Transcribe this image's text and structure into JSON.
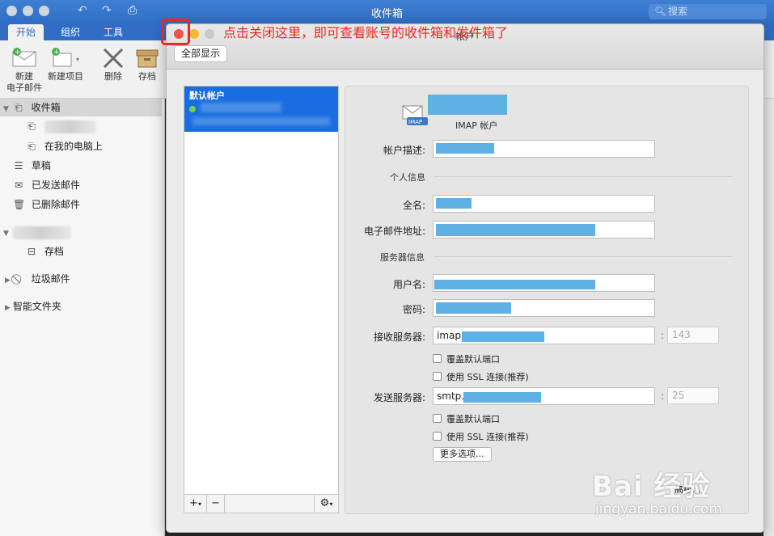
{
  "window": {
    "title": "收件箱"
  },
  "search": {
    "placeholder": "搜索"
  },
  "ribbon": {
    "tabs": [
      "开始",
      "组织",
      "工具"
    ],
    "buttons": {
      "new_email_line1": "新建",
      "new_email_line2": "电子邮件",
      "new_item": "新建项目",
      "delete": "删除",
      "archive": "存档"
    }
  },
  "sidebar": {
    "inbox": "收件箱",
    "on_my_computer": "在我的电脑上",
    "drafts": "草稿",
    "sent": "已发送邮件",
    "deleted": "已删除邮件",
    "archive": "存档",
    "junk": "垃圾邮件",
    "smart_folders": "智能文件夹"
  },
  "dialog": {
    "title": "帐户",
    "show_all": "全部显示",
    "default_account_label": "默认帐户",
    "account_type": "IMAP 帐户",
    "labels": {
      "description": "帐户描述:",
      "personal_info": "个人信息",
      "full_name": "全名:",
      "email": "电子邮件地址:",
      "server_info": "服务器信息",
      "username": "用户名:",
      "password": "密码:",
      "incoming": "接收服务器:",
      "outgoing": "发送服务器:"
    },
    "incoming_prefix": "imap.",
    "outgoing_prefix": "smtp.",
    "incoming_port": "143",
    "outgoing_port": "25",
    "override_port": "覆盖默认端口",
    "use_ssl": "使用 SSL 连接(推荐)",
    "more_options": "更多选项...",
    "advanced": "高级...",
    "list_add": "+",
    "list_remove": "−"
  },
  "annotation": {
    "text": "点击关闭这里，即可查看账号的收件箱和发件箱了"
  },
  "watermark": {
    "main": "Bai 经验",
    "sub": "jingyan.baidu.com"
  },
  "colors": {
    "accent": "#2f6ec4",
    "selection": "#1a6de0",
    "redaction": "#5eb0e5",
    "annotation": "#e82a22"
  }
}
